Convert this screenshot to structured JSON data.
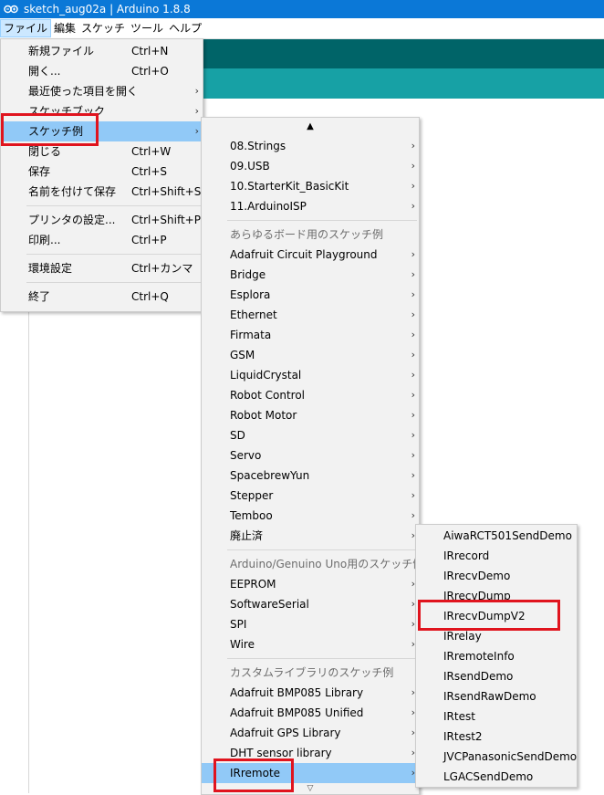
{
  "window": {
    "title": "sketch_aug02a | Arduino 1.8.8"
  },
  "menubar": [
    {
      "label": "ファイル",
      "active": true
    },
    {
      "label": "編集"
    },
    {
      "label": "スケッチ"
    },
    {
      "label": "ツール"
    },
    {
      "label": "ヘルプ"
    }
  ],
  "file_menu": {
    "groups": [
      [
        {
          "label": "新規ファイル",
          "shortcut": "Ctrl+N"
        },
        {
          "label": "開く...",
          "shortcut": "Ctrl+O"
        },
        {
          "label": "最近使った項目を開く",
          "submenu": true
        },
        {
          "label": "スケッチブック",
          "submenu": true
        },
        {
          "label": "スケッチ例",
          "submenu": true,
          "highlighted": true
        },
        {
          "label": "閉じる",
          "shortcut": "Ctrl+W"
        },
        {
          "label": "保存",
          "shortcut": "Ctrl+S"
        },
        {
          "label": "名前を付けて保存",
          "shortcut": "Ctrl+Shift+S"
        }
      ],
      [
        {
          "label": "プリンタの設定...",
          "shortcut": "Ctrl+Shift+P"
        },
        {
          "label": "印刷...",
          "shortcut": "Ctrl+P"
        }
      ],
      [
        {
          "label": "環境設定",
          "shortcut": "Ctrl+カンマ"
        }
      ],
      [
        {
          "label": "終了",
          "shortcut": "Ctrl+Q"
        }
      ]
    ]
  },
  "examples_menu": {
    "scroll_up": "▲",
    "scroll_down": "▽",
    "groups": [
      {
        "items": [
          {
            "label": "08.Strings",
            "submenu": true
          },
          {
            "label": "09.USB",
            "submenu": true
          },
          {
            "label": "10.StarterKit_BasicKit",
            "submenu": true
          },
          {
            "label": "11.ArduinoISP",
            "submenu": true
          }
        ]
      },
      {
        "header": "あらゆるボード用のスケッチ例",
        "items": [
          {
            "label": "Adafruit Circuit Playground",
            "submenu": true
          },
          {
            "label": "Bridge",
            "submenu": true
          },
          {
            "label": "Esplora",
            "submenu": true
          },
          {
            "label": "Ethernet",
            "submenu": true
          },
          {
            "label": "Firmata",
            "submenu": true
          },
          {
            "label": "GSM",
            "submenu": true
          },
          {
            "label": "LiquidCrystal",
            "submenu": true
          },
          {
            "label": "Robot Control",
            "submenu": true
          },
          {
            "label": "Robot Motor",
            "submenu": true
          },
          {
            "label": "SD",
            "submenu": true
          },
          {
            "label": "Servo",
            "submenu": true
          },
          {
            "label": "SpacebrewYun",
            "submenu": true
          },
          {
            "label": "Stepper",
            "submenu": true
          },
          {
            "label": "Temboo",
            "submenu": true
          },
          {
            "label": "廃止済",
            "submenu": true
          }
        ]
      },
      {
        "header": "Arduino/Genuino Uno用のスケッチ例",
        "items": [
          {
            "label": "EEPROM",
            "submenu": true
          },
          {
            "label": "SoftwareSerial",
            "submenu": true
          },
          {
            "label": "SPI",
            "submenu": true
          },
          {
            "label": "Wire",
            "submenu": true
          }
        ]
      },
      {
        "header": "カスタムライブラリのスケッチ例",
        "items": [
          {
            "label": "Adafruit BMP085 Library",
            "submenu": true
          },
          {
            "label": "Adafruit BMP085 Unified",
            "submenu": true
          },
          {
            "label": "Adafruit GPS Library",
            "submenu": true
          },
          {
            "label": "DHT sensor library",
            "submenu": true
          },
          {
            "label": "IRremote",
            "submenu": true,
            "highlighted": true
          }
        ]
      }
    ]
  },
  "irremote_menu": {
    "items": [
      {
        "label": "AiwaRCT501SendDemo"
      },
      {
        "label": "IRrecord"
      },
      {
        "label": "IRrecvDemo"
      },
      {
        "label": "IRrecvDump"
      },
      {
        "label": "IRrecvDumpV2"
      },
      {
        "label": "IRrelay"
      },
      {
        "label": "IRremoteInfo"
      },
      {
        "label": "IRsendDemo"
      },
      {
        "label": "IRsendRawDemo"
      },
      {
        "label": "IRtest"
      },
      {
        "label": "IRtest2"
      },
      {
        "label": "JVCPanasonicSendDemo"
      },
      {
        "label": "LGACSendDemo"
      }
    ]
  },
  "colors": {
    "titlebar": "#0b78d7",
    "toolbar": "#006468",
    "tabs": "#17a1a5",
    "menu_bg": "#f2f2f2",
    "highlight": "#91c9f7",
    "annotation_red": "#e0141e"
  }
}
